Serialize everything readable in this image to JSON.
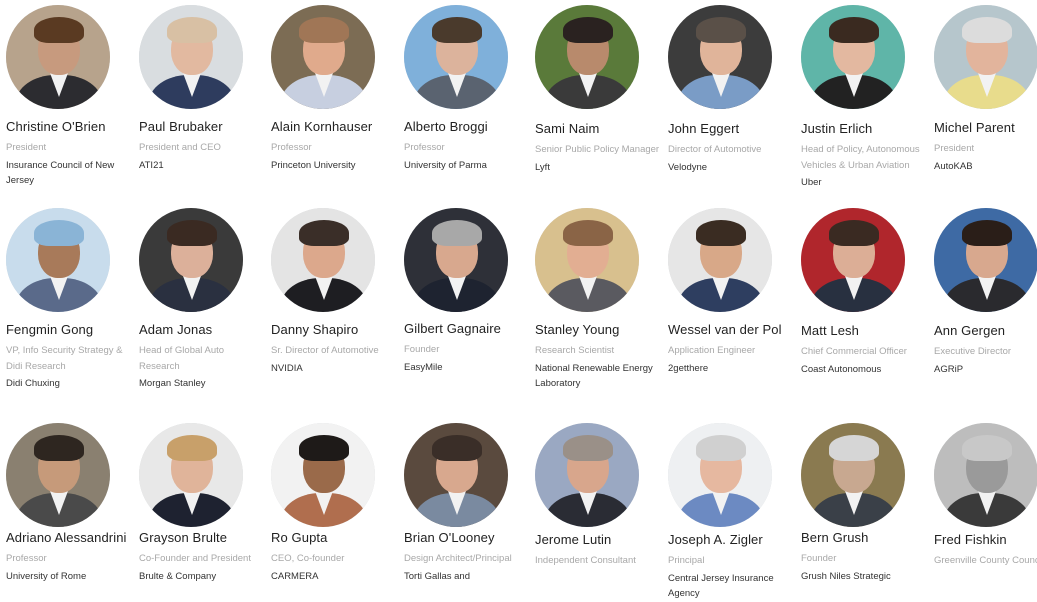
{
  "people": [
    {
      "name": "Christine O'Brien",
      "title": "President",
      "org": "Insurance Council of New Jersey",
      "skin": "#c79a7e",
      "hair": "#5a3a22",
      "shirt": "#2c2c30",
      "bg": "#b7a38c"
    },
    {
      "name": "Paul Brubaker",
      "title": "President and CEO",
      "org": "ATI21",
      "skin": "#e2b9a0",
      "hair": "#d8c0a4",
      "shirt": "#2e3c5e",
      "bg": "#d9dde0"
    },
    {
      "name": "Alain Kornhauser",
      "title": "Professor",
      "org": "Princeton University",
      "skin": "#e0aa8c",
      "hair": "#a07656",
      "shirt": "#c7cfe0",
      "bg": "#7c6c54"
    },
    {
      "name": "Alberto Broggi",
      "title": "Professor",
      "org": "University of Parma",
      "skin": "#dcb39c",
      "hair": "#4a3a2c",
      "shirt": "#5a6370",
      "bg": "#7fb0da"
    },
    {
      "name": "Sami Naim",
      "title": "Senior Public Policy Manager",
      "org": "Lyft",
      "skin": "#b88a6c",
      "hair": "#2a2220",
      "shirt": "#3a3a3a",
      "bg": "#5a7a3a"
    },
    {
      "name": "John Eggert",
      "title": "Director of Automotive",
      "org": "Velodyne",
      "skin": "#e0b49a",
      "hair": "#5a5048",
      "shirt": "#7a9cc6",
      "bg": "#3c3c3c"
    },
    {
      "name": "Justin Erlich",
      "title": "Head of Policy, Autonomous Vehicles & Urban Aviation",
      "org": "Uber",
      "skin": "#e3b8a0",
      "hair": "#3a2a20",
      "shirt": "#222222",
      "bg": "#5fb5a8"
    },
    {
      "name": "Michel Parent",
      "title": "President",
      "org": "AutoKAB",
      "skin": "#e2b49c",
      "hair": "#dcdcdc",
      "shirt": "#e8dc8c",
      "bg": "#b6c6cc"
    },
    {
      "name": "Fengmin Gong",
      "title": "VP, Info Security Strategy & Didi Research",
      "org": "Didi Chuxing",
      "skin": "#a87a5a",
      "hair": "#8ab4d6",
      "shirt": "#5a6a8a",
      "bg": "#c8dcec"
    },
    {
      "name": "Adam Jonas",
      "title": "Head of Global Auto Research",
      "org": "Morgan Stanley",
      "skin": "#dcb09a",
      "hair": "#3a2a22",
      "shirt": "#2a3040",
      "bg": "#3a3a3a"
    },
    {
      "name": "Danny Shapiro",
      "title": "Sr. Director of Automotive",
      "org": "NVIDIA",
      "skin": "#dca88c",
      "hair": "#3a2e28",
      "shirt": "#1e1e22",
      "bg": "#e4e4e4"
    },
    {
      "name": "Gilbert Gagnaire",
      "title": "Founder",
      "org": "EasyMile",
      "skin": "#d8a88e",
      "hair": "#a8a8a8",
      "shirt": "#1e2330",
      "bg": "#2e3038"
    },
    {
      "name": "Stanley Young",
      "title": "Research Scientist",
      "org": "National Renewable Energy Laboratory",
      "skin": "#e2ae92",
      "hair": "#8a6446",
      "shirt": "#5a5a60",
      "bg": "#d8c08e"
    },
    {
      "name": "Wessel van der Pol",
      "title": "Application Engineer",
      "org": "2getthere",
      "skin": "#d8a888",
      "hair": "#3a2c22",
      "shirt": "#2e3e60",
      "bg": "#e6e6e6"
    },
    {
      "name": "Matt Lesh",
      "title": "Chief Commercial Officer",
      "org": "Coast Autonomous",
      "skin": "#dcae96",
      "hair": "#3a2a22",
      "shirt": "#283040",
      "bg": "#b0262c"
    },
    {
      "name": "Ann Gergen",
      "title": "Executive Director",
      "org": "AGRiP",
      "skin": "#d8a88e",
      "hair": "#2a1e18",
      "shirt": "#2a2a2e",
      "bg": "#3e6aa4"
    },
    {
      "name": "Adriano Alessandrini",
      "title": "Professor",
      "org": "University of Rome",
      "skin": "#c69a7a",
      "hair": "#2e2620",
      "shirt": "#4a4a4a",
      "bg": "#8a8070"
    },
    {
      "name": "Grayson Brulte",
      "title": "Co-Founder and President",
      "org": "Brulte & Company",
      "skin": "#e0b49a",
      "hair": "#c8a06a",
      "shirt": "#1e2230",
      "bg": "#e8e8e8"
    },
    {
      "name": "Ro Gupta",
      "title": "CEO, Co-founder",
      "org": "CARMERA",
      "skin": "#9a6a4a",
      "hair": "#1e1a18",
      "shirt": "#b06e4e",
      "bg": "#f2f2f2"
    },
    {
      "name": "Brian O'Looney",
      "title": "Design Architect/Principal",
      "org": "Torti Gallas and",
      "skin": "#d8a88e",
      "hair": "#3a2e28",
      "shirt": "#7a8aa0",
      "bg": "#5a4a3e"
    },
    {
      "name": "Jerome Lutin",
      "title": "Independent Consultant",
      "org": "",
      "skin": "#d8a68c",
      "hair": "#9a9088",
      "shirt": "#2a2c34",
      "bg": "#9aa8c2"
    },
    {
      "name": "Joseph A. Zigler",
      "title": "Principal",
      "org": "Central Jersey Insurance Agency",
      "skin": "#e6b8a0",
      "hair": "#d0d0d0",
      "shirt": "#6c8ac2",
      "bg": "#eef0f2"
    },
    {
      "name": "Bern Grush",
      "title": "Founder",
      "org": "Grush Niles Strategic",
      "skin": "#c8a890",
      "hair": "#d6d6d6",
      "shirt": "#3a4048",
      "bg": "#8a7a50"
    },
    {
      "name": "Fred Fishkin",
      "title": "Greenville County Council",
      "org": "",
      "skin": "#9a9a9a",
      "hair": "#c8c8c8",
      "shirt": "#3a3a3a",
      "bg": "#bdbdbd"
    }
  ]
}
